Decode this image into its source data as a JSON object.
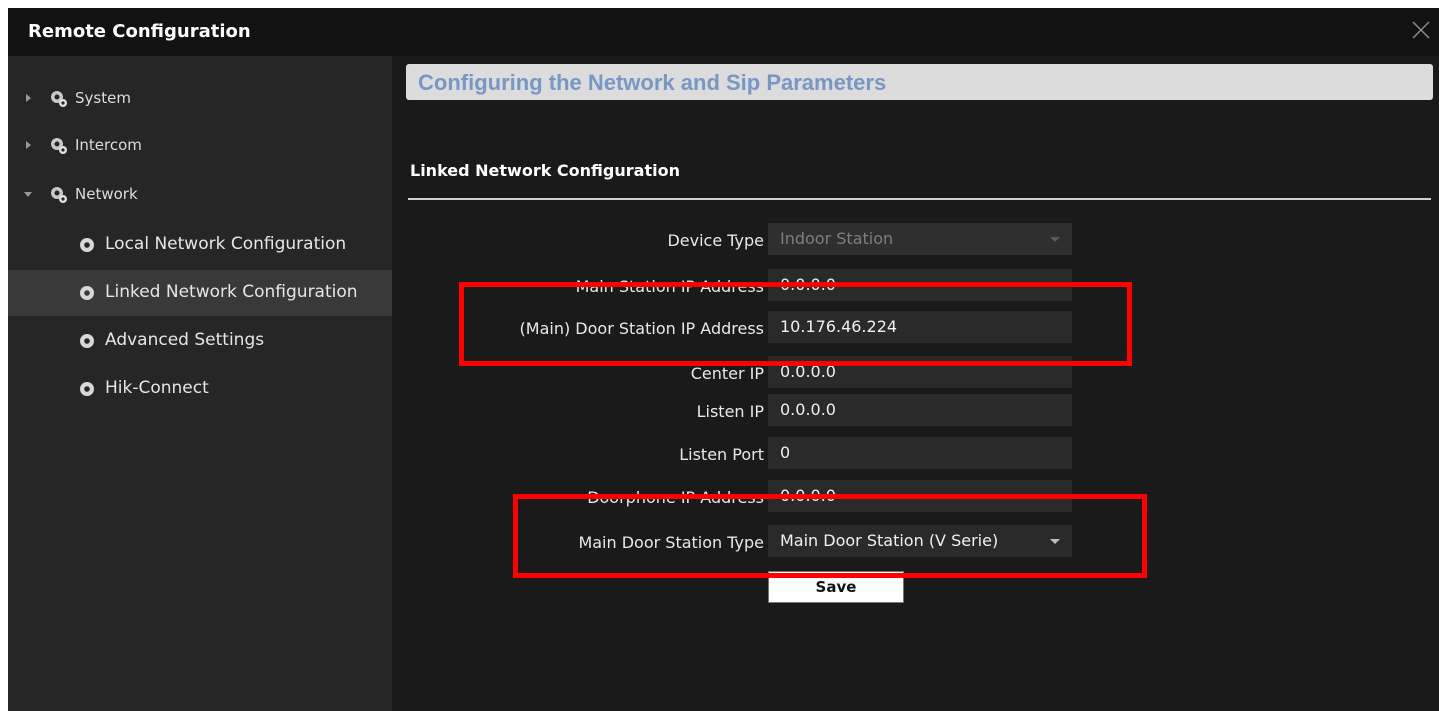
{
  "window": {
    "title": "Remote Configuration"
  },
  "sidebar": {
    "items": [
      {
        "label": "System"
      },
      {
        "label": "Intercom"
      },
      {
        "label": "Network"
      }
    ],
    "network_children": [
      {
        "label": "Local Network Configuration"
      },
      {
        "label": "Linked Network Configuration"
      },
      {
        "label": "Advanced Settings"
      },
      {
        "label": "Hik-Connect"
      }
    ]
  },
  "main": {
    "heading": "Configuring the Network and Sip Parameters",
    "section_title": "Linked Network Configuration",
    "fields": {
      "device_type": {
        "label": "Device Type",
        "value": "Indoor Station"
      },
      "main_station_ip": {
        "label": "Main Station IP Address",
        "value": "0.0.0.0"
      },
      "door_station_ip": {
        "label": "(Main) Door Station IP Address",
        "value": "10.176.46.224"
      },
      "center_ip": {
        "label": "Center IP",
        "value": "0.0.0.0"
      },
      "listen_ip": {
        "label": "Listen IP",
        "value": "0.0.0.0"
      },
      "listen_port": {
        "label": "Listen Port",
        "value": "0"
      },
      "doorphone_ip": {
        "label": "Doorphone IP Address",
        "value": "0.0.0.0"
      },
      "main_door_station_type": {
        "label": "Main Door Station Type",
        "value": "Main Door Station (V Serie)"
      }
    },
    "save_label": "Save"
  },
  "colors": {
    "highlight": "#ff0000",
    "heading_text": "#7897c4",
    "active_item_bg": "#393939"
  },
  "icons": [
    "close-icon",
    "arrow-right-icon",
    "arrow-down-icon",
    "gear-icon",
    "dropdown-caret-icon"
  ]
}
